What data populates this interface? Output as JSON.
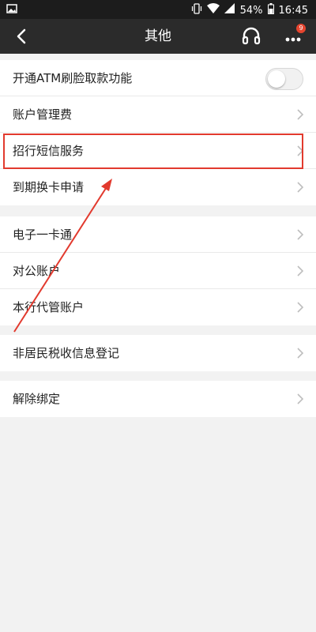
{
  "statusbar": {
    "battery": "54%",
    "time": "16:45",
    "icons": [
      "image-icon",
      "vibrate-icon",
      "wifi-icon",
      "signal-icon",
      "battery-icon"
    ]
  },
  "navbar": {
    "title": "其他",
    "badge": "9",
    "icons": [
      "back-arrow-icon",
      "headset-icon",
      "more-dots-icon"
    ]
  },
  "groups": {
    "g1": {
      "atm": "开通ATM刷脸取款功能",
      "fee": "账户管理费",
      "sms": "招行短信服务",
      "card": "到期换卡申请"
    },
    "g2": {
      "ecard": "电子一卡通",
      "corp": "对公账户",
      "agent": "本行代管账户"
    },
    "g3": {
      "tax": "非居民税收信息登记"
    },
    "g4": {
      "unbind": "解除绑定"
    }
  },
  "toggle": {
    "atm_enabled": false
  },
  "annotation": {
    "highlight_color": "#e23a2e"
  }
}
